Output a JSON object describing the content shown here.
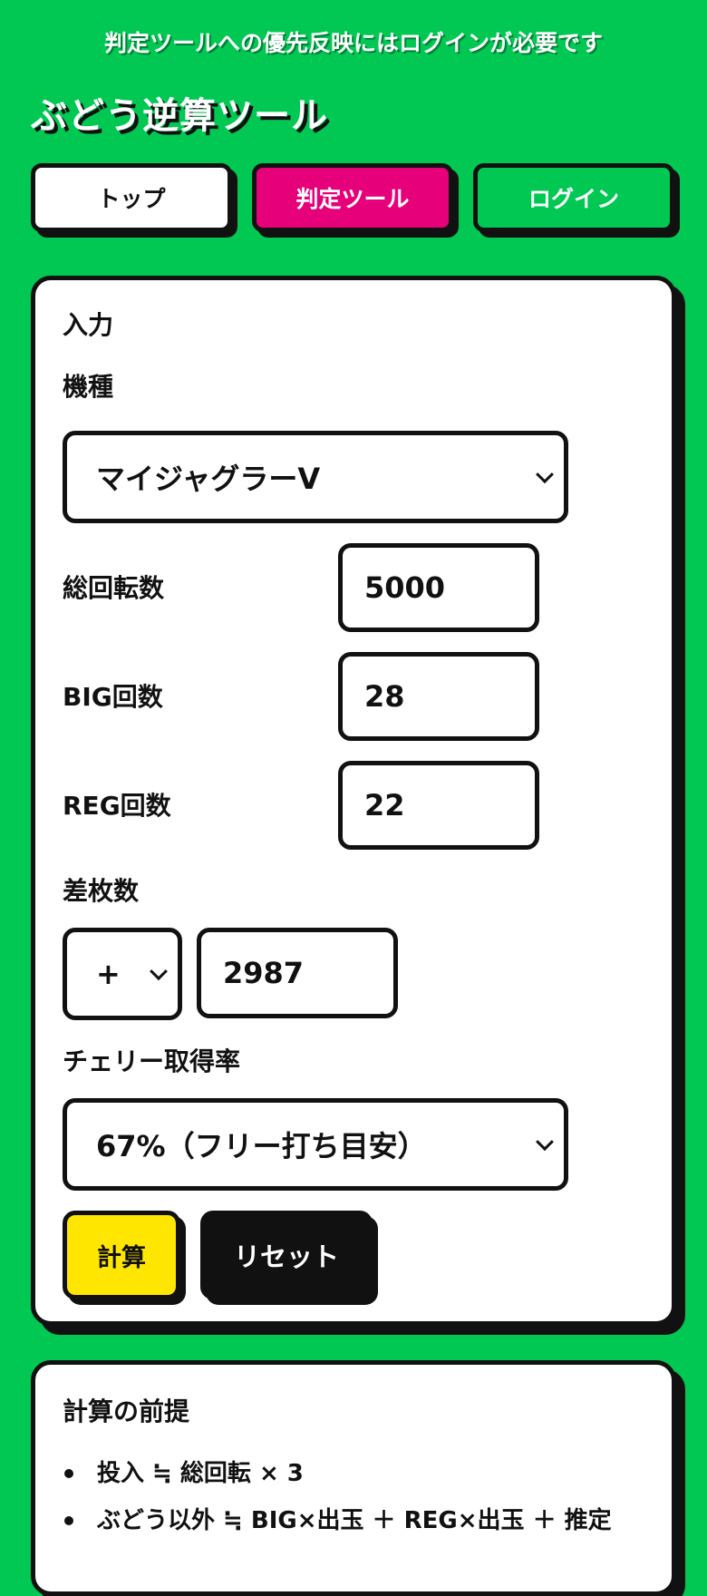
{
  "notice": "判定ツールへの優先反映にはログインが必要です",
  "app_title": "ぶどう逆算ツール",
  "nav": {
    "top": "トップ",
    "judge": "判定ツール",
    "login": "ログイン"
  },
  "input_card": {
    "title": "入力",
    "model_label": "機種",
    "model_value": "マイジャグラーV",
    "total_spins_label": "総回転数",
    "total_spins_value": "5000",
    "big_label": "BIG回数",
    "big_value": "28",
    "reg_label": "REG回数",
    "reg_value": "22",
    "diff_label": "差枚数",
    "diff_sign": "+",
    "diff_value": "2987",
    "cherry_label": "チェリー取得率",
    "cherry_value": "67%（フリー打ち目安）",
    "calc_button": "計算",
    "reset_button": "リセット"
  },
  "premise_card": {
    "title": "計算の前提",
    "items": [
      "投入 ≒ 総回転 × 3",
      "ぶどう以外 ≒ BIG×出玉 ＋ REG×出玉 ＋ 推定"
    ]
  },
  "colors": {
    "background": "#00c853",
    "accent_pink": "#e6007a",
    "accent_yellow": "#ffe600",
    "ink": "#111111"
  }
}
